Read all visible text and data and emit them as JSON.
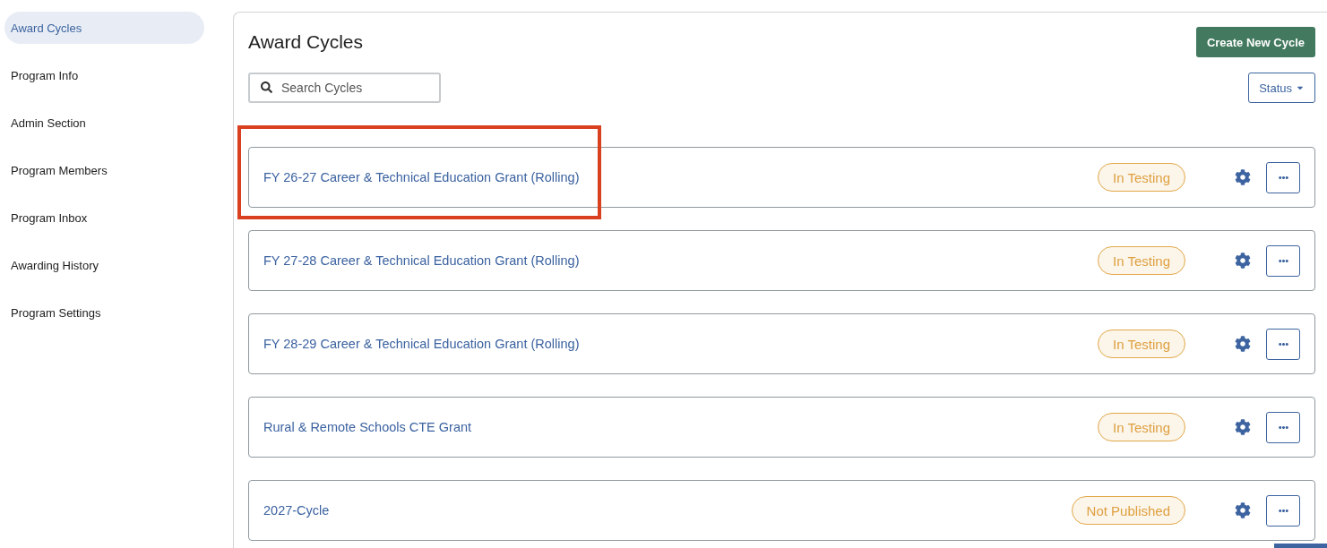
{
  "sidebar": {
    "items": [
      {
        "label": "Award Cycles",
        "selected": true
      },
      {
        "label": "Program Info",
        "selected": false
      },
      {
        "label": "Admin Section",
        "selected": false
      },
      {
        "label": "Program Members",
        "selected": false
      },
      {
        "label": "Program Inbox",
        "selected": false
      },
      {
        "label": "Awarding History",
        "selected": false
      },
      {
        "label": "Program Settings",
        "selected": false
      }
    ]
  },
  "main": {
    "title": "Award Cycles",
    "create_button": "Create New Cycle",
    "search": {
      "placeholder": "Search Cycles"
    },
    "status_filter": "Status"
  },
  "cycles": [
    {
      "name": "FY 26-27 Career & Technical Education Grant (Rolling)",
      "status": "In Testing",
      "highlighted": true
    },
    {
      "name": "FY 27-28 Career & Technical Education Grant (Rolling)",
      "status": "In Testing",
      "highlighted": false
    },
    {
      "name": "FY 28-29 Career & Technical Education Grant (Rolling)",
      "status": "In Testing",
      "highlighted": false
    },
    {
      "name": "Rural & Remote Schools CTE Grant",
      "status": "In Testing",
      "highlighted": false
    },
    {
      "name": "2027-Cycle",
      "status": "Not Published",
      "highlighted": false
    }
  ]
}
